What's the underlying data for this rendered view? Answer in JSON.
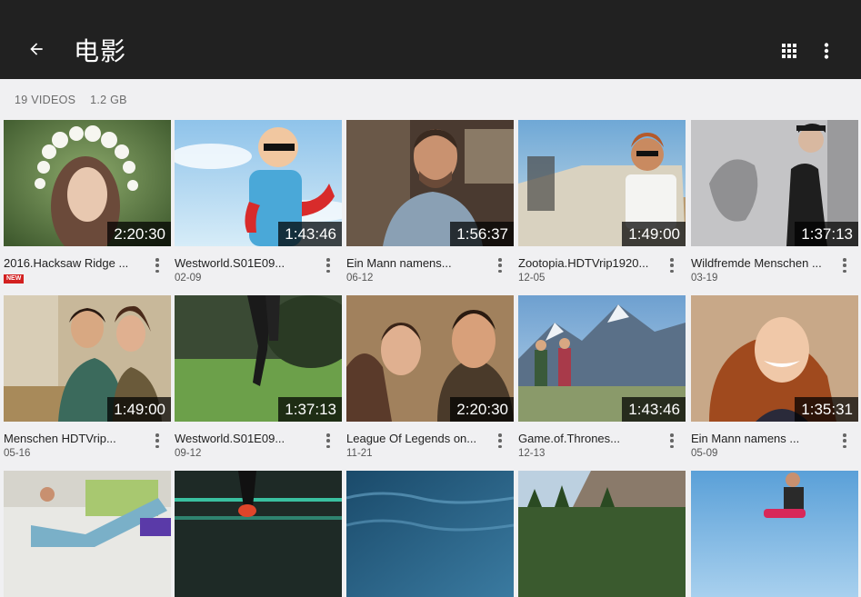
{
  "appbar": {
    "title": "电影",
    "back_icon": "arrow-back-icon",
    "grid_icon": "grid-view-icon",
    "more_icon": "more-vert-icon",
    "background": "#212121"
  },
  "summary": {
    "count": "19 VIDEOS",
    "size": "1.2 GB"
  },
  "videos": [
    {
      "title": "2016.Hacksaw Ridge ...",
      "date": "",
      "badge": "NEW",
      "duration": "2:20:30"
    },
    {
      "title": "Westworld.S01E09...",
      "date": "02-09",
      "badge": "",
      "duration": "1:43:46"
    },
    {
      "title": "Ein Mann namens...",
      "date": "06-12",
      "badge": "",
      "duration": "1:56:37"
    },
    {
      "title": "Zootopia.HDTVrip1920...",
      "date": "12-05",
      "badge": "",
      "duration": "1:49:00"
    },
    {
      "title": "Wildfremde Menschen ...",
      "date": "03-19",
      "badge": "",
      "duration": "1:37:13"
    },
    {
      "title": "Menschen HDTVrip...",
      "date": "05-16",
      "badge": "",
      "duration": "1:49:00"
    },
    {
      "title": "Westworld.S01E09...",
      "date": "09-12",
      "badge": "",
      "duration": "1:37:13"
    },
    {
      "title": "League Of Legends on...",
      "date": "11-21",
      "badge": "",
      "duration": "2:20:30"
    },
    {
      "title": "Game.of.Thrones...",
      "date": "12-13",
      "badge": "",
      "duration": "1:43:46"
    },
    {
      "title": "Ein Mann namens ...",
      "date": "05-09",
      "badge": "",
      "duration": "1:35:31"
    },
    {
      "title": "",
      "date": "",
      "badge": "",
      "duration": ""
    },
    {
      "title": "",
      "date": "",
      "badge": "",
      "duration": ""
    },
    {
      "title": "",
      "date": "",
      "badge": "",
      "duration": ""
    },
    {
      "title": "",
      "date": "",
      "badge": "",
      "duration": ""
    },
    {
      "title": "",
      "date": "",
      "badge": "",
      "duration": ""
    }
  ]
}
